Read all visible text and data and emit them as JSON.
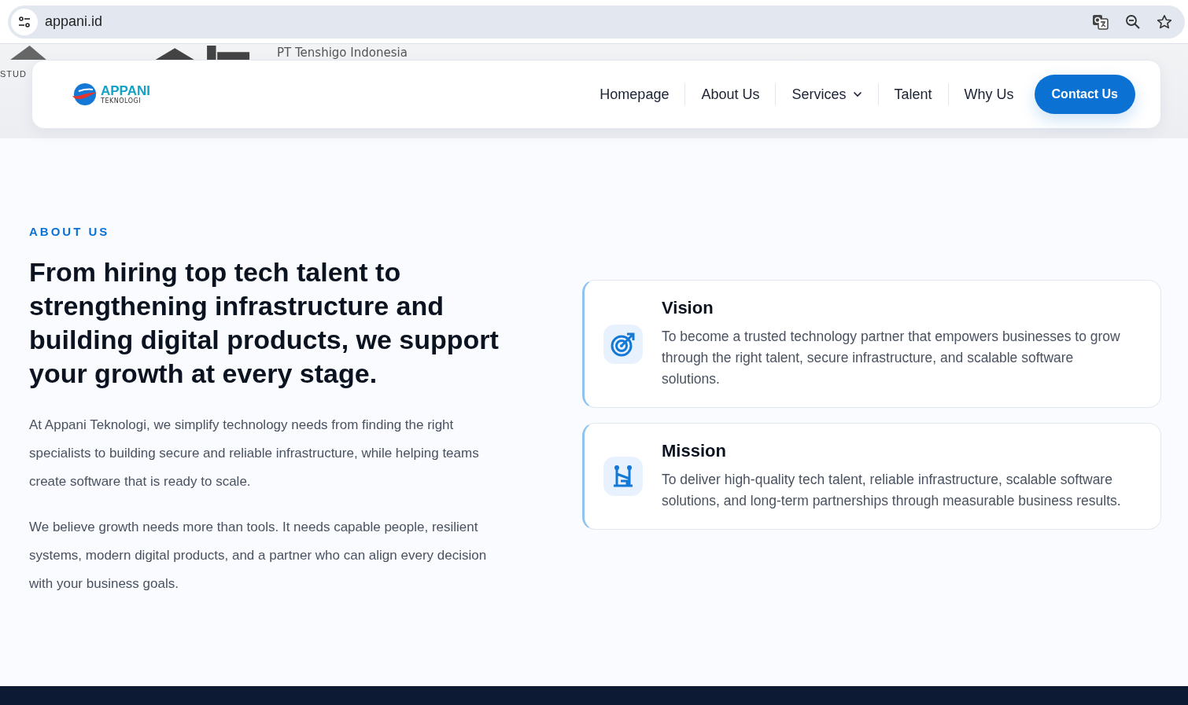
{
  "browser": {
    "url": "appani.id"
  },
  "partner_strip": {
    "items": [
      {
        "text": "STUD"
      },
      {
        "text": "PT Tenshigo Indonesia"
      }
    ]
  },
  "navbar": {
    "logo": {
      "name": "APPANI",
      "tagline": "TEKNOLOGI"
    },
    "items": [
      {
        "label": "Homepage",
        "has_menu": false
      },
      {
        "label": "About Us",
        "has_menu": false
      },
      {
        "label": "Services",
        "has_menu": true
      },
      {
        "label": "Talent",
        "has_menu": false
      },
      {
        "label": "Why Us",
        "has_menu": false
      }
    ],
    "cta": "Contact Us"
  },
  "about": {
    "eyebrow": "ABOUT US",
    "heading": "From hiring top tech talent to strengthening infrastructure and building digital products, we support your growth at every stage.",
    "paragraphs": [
      "At Appani Teknologi, we simplify technology needs from finding the right specialists to building secure and reliable infrastructure, while helping teams create software that is ready to scale.",
      "We believe growth needs more than tools. It needs capable people, resilient systems, modern digital products, and a partner who can align every decision with your business goals."
    ],
    "cards": [
      {
        "kind": "target",
        "title": "Vision",
        "text": "To become a trusted technology partner that empowers businesses to grow through the right talent, secure infrastructure, and scalable software solutions."
      },
      {
        "kind": "structure",
        "title": "Mission",
        "text": "To deliver high-quality tech talent, reliable infrastructure, scalable software solutions, and long-term partnerships through measurable business results."
      }
    ]
  }
}
